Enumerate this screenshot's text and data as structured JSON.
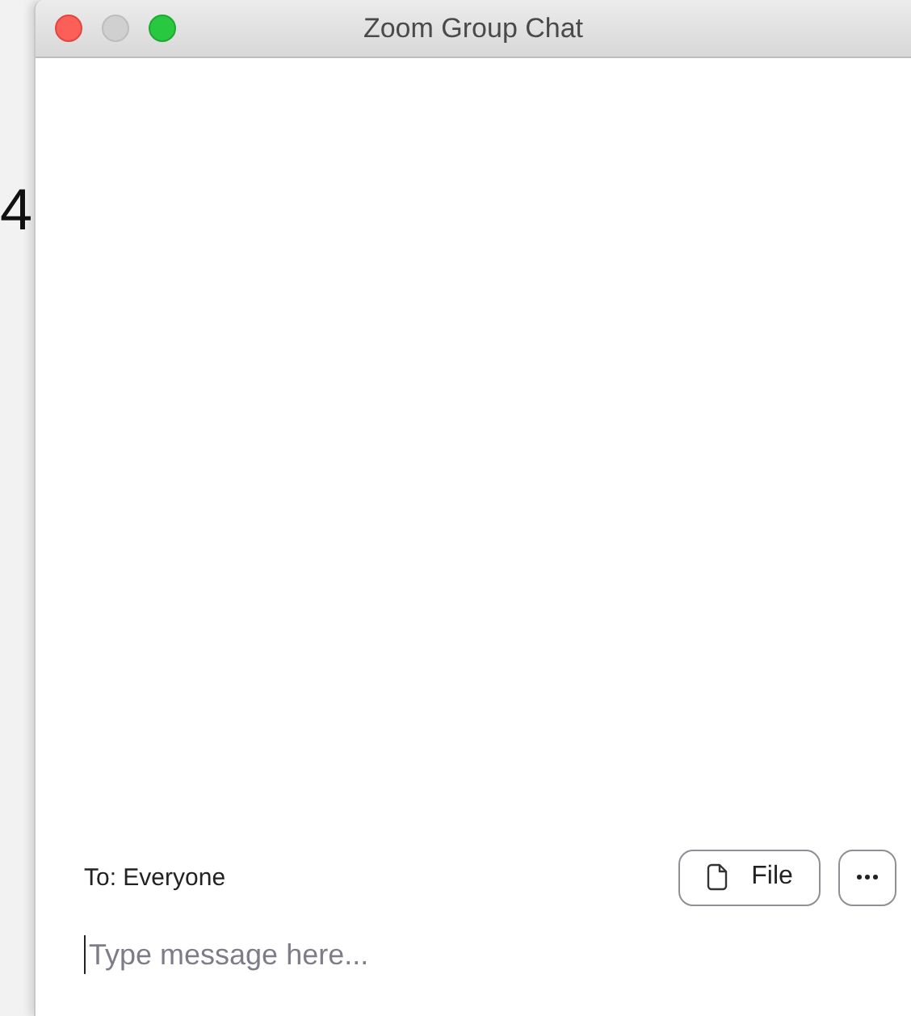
{
  "background": {
    "text": "4"
  },
  "window": {
    "title": "Zoom Group Chat"
  },
  "composer": {
    "recipient": "To: Everyone",
    "file_button": "File",
    "message": {
      "placeholder": "Type message here..."
    }
  }
}
